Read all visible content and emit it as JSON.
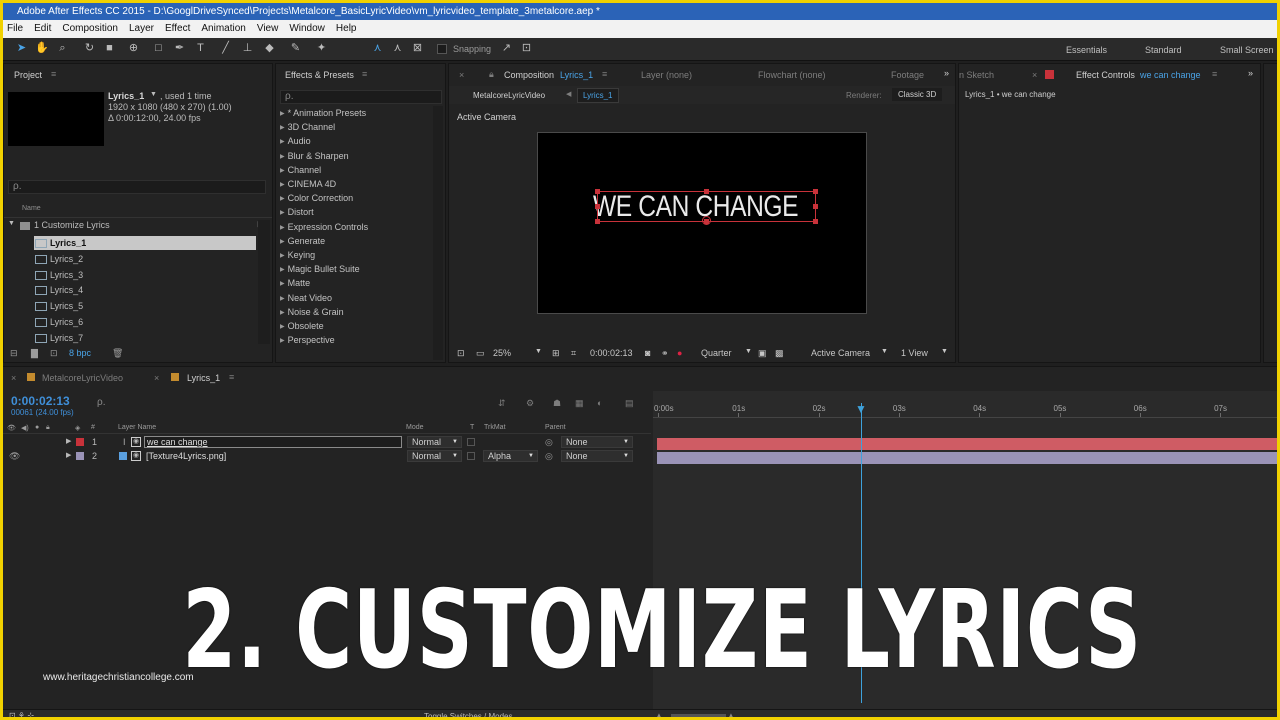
{
  "window": {
    "title": "Adobe After Effects CC 2015 - D:\\GooglDriveSynced\\Projects\\Metalcore_BasicLyricVideo\\vm_lyricvideo_template_3metalcore.aep *"
  },
  "menu": [
    "File",
    "Edit",
    "Composition",
    "Layer",
    "Effect",
    "Animation",
    "View",
    "Window",
    "Help"
  ],
  "toolbar": {
    "snapping_label": "Snapping",
    "workspaces": [
      "Essentials",
      "Standard",
      "Small Screen"
    ]
  },
  "project": {
    "tab": "Project",
    "selected_name": "Lyrics_1",
    "used": ", used 1 time",
    "dims": "1920 x 1080  (480 x 270) (1.00)",
    "duration": "Δ 0:00:12:00, 24.00 fps",
    "search": "ρ.",
    "name_header": "Name",
    "folder": "1 Customize Lyrics",
    "items": [
      "Lyrics_1",
      "Lyrics_2",
      "Lyrics_3",
      "Lyrics_4",
      "Lyrics_5",
      "Lyrics_6",
      "Lyrics_7"
    ],
    "bpc": "8 bpc"
  },
  "effects": {
    "tab": "Effects & Presets",
    "search": "ρ.",
    "items": [
      "* Animation Presets",
      "3D Channel",
      "Audio",
      "Blur & Sharpen",
      "Channel",
      "CINEMA 4D",
      "Color Correction",
      "Distort",
      "Expression Controls",
      "Generate",
      "Keying",
      "Magic Bullet Suite",
      "Matte",
      "Neat Video",
      "Noise & Grain",
      "Obsolete",
      "Perspective"
    ]
  },
  "comp": {
    "tab_label": "Composition",
    "tab_comp": "Lyrics_1",
    "layer_tab": "Layer (none)",
    "flowchart_tab": "Flowchart (none)",
    "footage_tab": "Footage",
    "breadcrumb_parent": "MetalcoreLyricVideo",
    "breadcrumb_current": "Lyrics_1",
    "renderer_label": "Renderer:",
    "renderer_value": "Classic 3D",
    "active_camera": "Active Camera",
    "canvas_text": "WE CAN CHANGE",
    "zoom": "25%",
    "timecode": "0:00:02:13",
    "resolution": "Quarter",
    "view": "Active Camera",
    "views": "1 View"
  },
  "effect_controls": {
    "sketch_tab": "n Sketch",
    "tab_label": "Effect Controls",
    "tab_layer": "we can change",
    "breadcrumb": "Lyrics_1 • we can change"
  },
  "timeline": {
    "tabs": [
      "MetalcoreLyricVideo",
      "Lyrics_1"
    ],
    "timecode": "0:00:02:13",
    "frames": "00061 (24.00 fps)",
    "search": "ρ.",
    "columns": {
      "hash": "#",
      "layer_name": "Layer Name",
      "mode": "Mode",
      "t": "T",
      "trkmat": "TrkMat",
      "parent": "Parent"
    },
    "layers": [
      {
        "num": "1",
        "name": "we can change",
        "mode": "Normal",
        "trkmat": "",
        "parent": "None",
        "color": "#c8323a"
      },
      {
        "num": "2",
        "name": "[Texture4Lyrics.png]",
        "mode": "Normal",
        "trkmat": "Alpha",
        "parent": "None",
        "color": "#9a93b7"
      }
    ],
    "ruler": [
      "0:00s",
      "01s",
      "02s",
      "03s",
      "04s",
      "05s",
      "06s",
      "07s"
    ],
    "bar_colors": [
      "#cf5c64",
      "#9a93b7"
    ]
  },
  "overlay": {
    "title": "2. CUSTOMIZE LYRICS",
    "watermark": "www.heritagechristiancollege.com"
  },
  "status": {
    "toggle": "Toggle Switches / Modes"
  }
}
